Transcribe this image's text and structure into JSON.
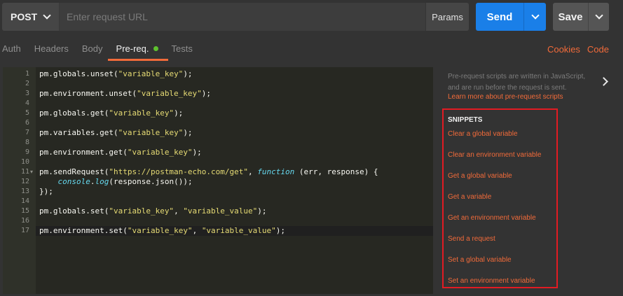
{
  "request": {
    "method": "POST",
    "url_placeholder": "Enter request URL",
    "url_value": "",
    "params_label": "Params",
    "send_label": "Send",
    "save_label": "Save"
  },
  "tabs": [
    {
      "label": "Auth",
      "active": false
    },
    {
      "label": "Headers",
      "active": false
    },
    {
      "label": "Body",
      "active": false
    },
    {
      "label": "Pre-req.",
      "active": true,
      "status_dot": true
    },
    {
      "label": "Tests",
      "active": false
    }
  ],
  "right_links": {
    "cookies": "Cookies",
    "code": "Code"
  },
  "editor": {
    "line_numbers": [
      "1",
      "2",
      "3",
      "4",
      "5",
      "6",
      "7",
      "8",
      "9",
      "10",
      "11",
      "12",
      "13",
      "14",
      "15",
      "16",
      "17"
    ],
    "lines": [
      {
        "n": 1,
        "parts": [
          [
            "t",
            "pm.globals.unset("
          ],
          [
            "s",
            "\"variable_key\""
          ],
          [
            "t",
            ");"
          ]
        ]
      },
      {
        "n": 3,
        "parts": [
          [
            "t",
            "pm.environment.unset("
          ],
          [
            "s",
            "\"variable_key\""
          ],
          [
            "t",
            ");"
          ]
        ]
      },
      {
        "n": 5,
        "parts": [
          [
            "t",
            "pm.globals.get("
          ],
          [
            "s",
            "\"variable_key\""
          ],
          [
            "t",
            ");"
          ]
        ]
      },
      {
        "n": 7,
        "parts": [
          [
            "t",
            "pm.variables.get("
          ],
          [
            "s",
            "\"variable_key\""
          ],
          [
            "t",
            ");"
          ]
        ]
      },
      {
        "n": 9,
        "parts": [
          [
            "t",
            "pm.environment.get("
          ],
          [
            "s",
            "\"variable_key\""
          ],
          [
            "t",
            ");"
          ]
        ]
      },
      {
        "n": 11,
        "parts": [
          [
            "t",
            "pm.sendRequest("
          ],
          [
            "s",
            "\"https://postman-echo.com/get\""
          ],
          [
            "t",
            ", "
          ],
          [
            "k",
            "function"
          ],
          [
            "t",
            " (err, response) {"
          ]
        ]
      },
      {
        "n": 12,
        "parts": [
          [
            "t",
            "    "
          ],
          [
            "k",
            "console"
          ],
          [
            "t",
            "."
          ],
          [
            "k",
            "log"
          ],
          [
            "t",
            "(response.json());"
          ]
        ]
      },
      {
        "n": 13,
        "parts": [
          [
            "t",
            "});"
          ]
        ]
      },
      {
        "n": 15,
        "parts": [
          [
            "t",
            "pm.globals.set("
          ],
          [
            "s",
            "\"variable_key\""
          ],
          [
            "t",
            ", "
          ],
          [
            "s",
            "\"variable_value\""
          ],
          [
            "t",
            ");"
          ]
        ]
      },
      {
        "n": 17,
        "parts": [
          [
            "t",
            "pm.environment.set("
          ],
          [
            "s",
            "\"variable_key\""
          ],
          [
            "t",
            ", "
          ],
          [
            "s",
            "\"variable_value\""
          ],
          [
            "t",
            ");"
          ]
        ]
      }
    ],
    "fold_line": 11,
    "active_line": 17
  },
  "sidebar": {
    "description": "Pre-request scripts are written in JavaScript, and are run before the request is sent.",
    "learn_link": "Learn more about pre-request scripts",
    "snippets_title": "SNIPPETS",
    "snippets": [
      "Clear a global variable",
      "Clear an environment variable",
      "Get a global variable",
      "Get a variable",
      "Get an environment variable",
      "Send a request",
      "Set a global variable",
      "Set an environment variable"
    ]
  },
  "colors": {
    "accent": "#f26b3a",
    "send": "#1a7fe8",
    "highlight_border": "#e21b23",
    "status_dot": "#5ec22e"
  }
}
